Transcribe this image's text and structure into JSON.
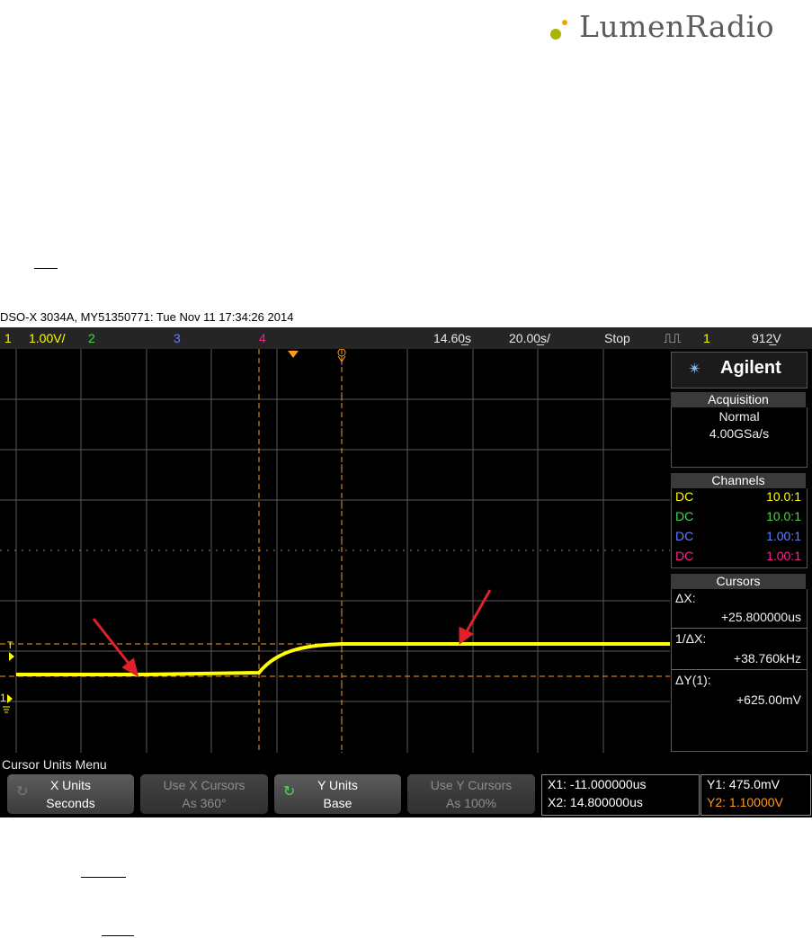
{
  "logo": {
    "text": "LumenRadio"
  },
  "scope": {
    "title": "DSO-X 3034A, MY51350771: Tue Nov 11 17:34:26 2014",
    "topbar": {
      "ch1": "1",
      "ch1_scale": "1.00V/",
      "ch2": "2",
      "ch3": "3",
      "ch4": "4",
      "delay": "14.60̲s",
      "timebase": "20.00̲s/",
      "run_state": "Stop",
      "trigger_ch": "1",
      "trigger_level": "912̲V"
    },
    "markers": {
      "trigger_level": "T",
      "ground": "1"
    },
    "brand": "Agilent",
    "acquisition": {
      "header": "Acquisition",
      "mode": "Normal",
      "rate": "4.00GSa/s"
    },
    "channels": {
      "header": "Channels",
      "rows": [
        {
          "coupling": "DC",
          "probe": "10.0:1",
          "color": "#ffff00"
        },
        {
          "coupling": "DC",
          "probe": "10.0:1",
          "color": "#4cd44c"
        },
        {
          "coupling": "DC",
          "probe": "1.00:1",
          "color": "#6080ff"
        },
        {
          "coupling": "DC",
          "probe": "1.00:1",
          "color": "#ff2090"
        }
      ]
    },
    "cursors": {
      "header": "Cursors",
      "dx_label": "ΔX:",
      "dx_value": "+25.800000us",
      "inv_dx_label": "1/ΔX:",
      "inv_dx_value": "+38.760kHz",
      "dy_label": "ΔY(1):",
      "dy_value": "+625.00mV"
    },
    "menu": {
      "title": "Cursor Units Menu",
      "softkeys": [
        {
          "line1": "X Units",
          "line2": "Seconds"
        },
        {
          "line1": "Use X Cursors",
          "line2": "As 360°"
        },
        {
          "line1": "Y Units",
          "line2": "Base"
        },
        {
          "line1": "Use Y Cursors",
          "line2": "As 100%"
        }
      ],
      "x_readout": {
        "x1": "X1: -11.000000us",
        "x2": "X2: 14.800000us"
      },
      "y_readout": {
        "y1": "Y1: 475.0mV",
        "y2": "Y2: 1.10000V"
      }
    },
    "colors": {
      "ch1": "#ffff00",
      "ch2": "#4cd44c",
      "ch3": "#6080ff",
      "ch4": "#ff2090",
      "cursor": "#ff9a1a",
      "annotation_arrow": "#e0202a"
    }
  }
}
